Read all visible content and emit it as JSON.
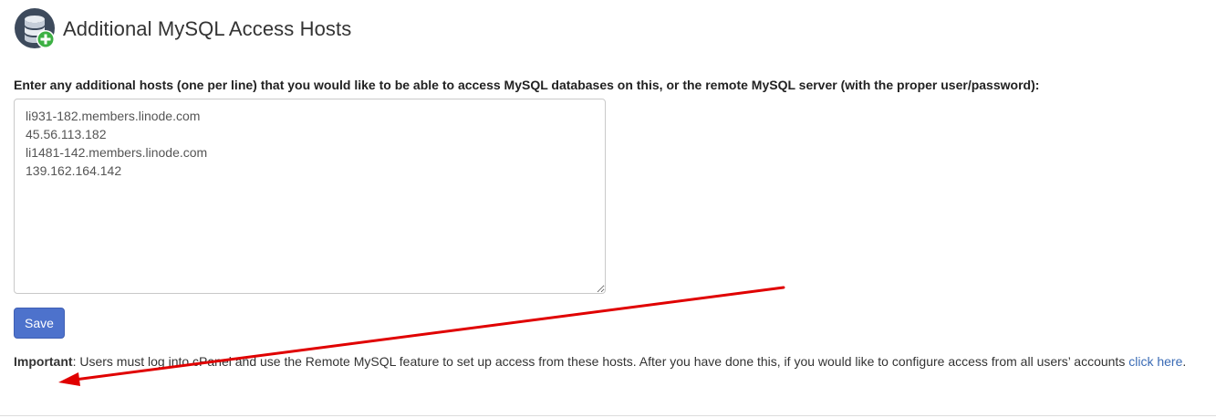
{
  "header": {
    "title": "Additional MySQL Access Hosts",
    "icon": "database-add-icon"
  },
  "form": {
    "label": "Enter any additional hosts (one per line) that you would like to be able to access MySQL databases on this, or the remote MySQL server (with the proper user/password):",
    "hosts_value": "li931-182.members.linode.com\n45.56.113.182\nli1481-142.members.linode.com\n139.162.164.142",
    "save_label": "Save"
  },
  "notice": {
    "important_label": "Important",
    "text": ": Users must log into cPanel and use the Remote MySQL feature to set up access from these hosts. After you have done this, if you would like to configure access from all users’ accounts ",
    "link_label": "click here",
    "trailing": "."
  },
  "annotation": {
    "arrow_color": "#e00000"
  },
  "colors": {
    "accent": "#4d72cc",
    "link": "#3a6bb5",
    "icon_dark": "#3d4a5c",
    "icon_green": "#3cb043"
  }
}
